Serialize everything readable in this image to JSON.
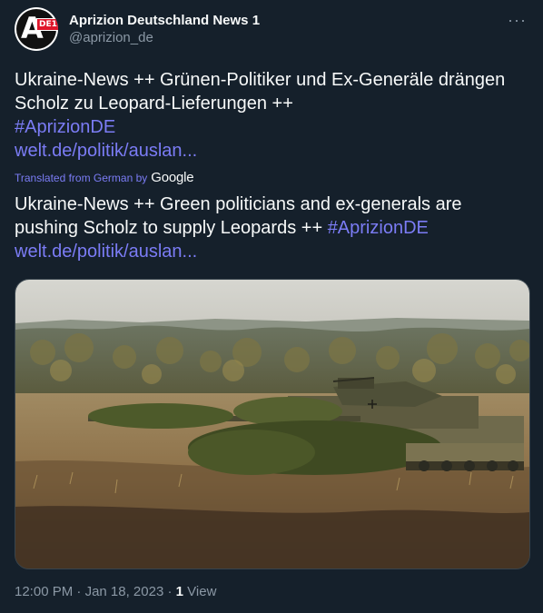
{
  "author": {
    "display_name": "Aprizion Deutschland News 1",
    "handle": "@aprizion_de",
    "avatar_text_a": "A",
    "avatar_badge": "DE1"
  },
  "more_icon": "···",
  "original": {
    "text": "Ukraine-News ++ Grünen-Politiker und Ex-Generäle drängen Scholz zu Leopard-Lieferungen ++",
    "hashtag": "#AprizionDE",
    "link": "welt.de/politik/auslan..."
  },
  "translation": {
    "label": "Translated from German by",
    "provider": "Google",
    "text": "Ukraine-News ++ Green politicians and ex-generals are pushing Scholz to supply Leopards ++",
    "hashtag": "#AprizionDE",
    "link": "welt.de/politik/auslan..."
  },
  "meta": {
    "time": "12:00 PM",
    "date": "Jan 18, 2023",
    "views_count": "1",
    "views_label": "View",
    "separator": "·"
  },
  "colors": {
    "background": "#15202b",
    "link": "#7b7cf5",
    "secondary_text": "#8b98a5",
    "primary_text": "#f7f9f9",
    "badge_red": "#e0162b"
  }
}
